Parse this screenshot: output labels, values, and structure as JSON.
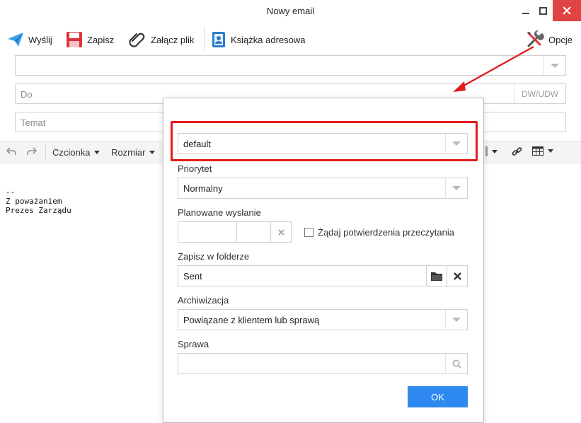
{
  "window": {
    "title": "Nowy email"
  },
  "toolbar": {
    "send": "Wyślij",
    "save": "Zapisz",
    "attach": "Załącz plik",
    "addressbook": "Książka adresowa",
    "options": "Opcje"
  },
  "fields": {
    "to_placeholder": "Do",
    "cc": "DW/UDW",
    "subject_placeholder": "Temat"
  },
  "editor": {
    "font": "Czcionka",
    "size": "Rozmiar"
  },
  "signature": [
    "--",
    "Z poważaniem",
    "Prezes Zarządu"
  ],
  "dialog": {
    "identity": "default",
    "priority_label": "Priorytet",
    "priority_value": "Normalny",
    "scheduled_label": "Planowane wysłanie",
    "read_receipt_label": "Żądaj potwierdzenia przeczytania",
    "folder_label": "Zapisz w folderze",
    "folder_value": "Sent",
    "archive_label": "Archiwizacja",
    "archive_value": "Powiązane z klientem lub sprawą",
    "case_label": "Sprawa",
    "ok": "OK"
  },
  "colors": {
    "accent": "#2d89ef",
    "highlight": "#e21b1b",
    "close": "#e04343"
  }
}
